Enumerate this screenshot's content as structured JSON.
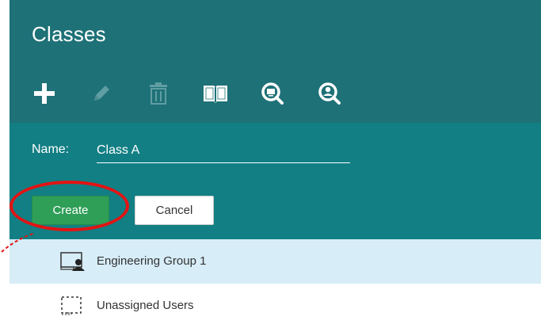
{
  "header": {
    "title": "Classes"
  },
  "toolbar": [
    {
      "name": "add-icon",
      "enabled": true
    },
    {
      "name": "edit-icon",
      "enabled": false
    },
    {
      "name": "delete-icon",
      "enabled": false
    },
    {
      "name": "book-icon",
      "enabled": true
    },
    {
      "name": "monitor-search-icon",
      "enabled": true
    },
    {
      "name": "user-search-icon",
      "enabled": true
    }
  ],
  "form": {
    "name_label": "Name:",
    "name_value": "Class A",
    "create_label": "Create",
    "cancel_label": "Cancel"
  },
  "list": {
    "items": [
      {
        "label": "Engineering Group 1",
        "icon": "computer-group-icon",
        "selected": true
      },
      {
        "label": "Unassigned Users",
        "icon": "dashed-group-icon",
        "selected": false
      }
    ]
  },
  "colors": {
    "header_bg": "#1e7177",
    "form_bg": "#127f84",
    "create_button": "#2f9e57",
    "selected_row": "#d7edf7",
    "highlight": "#e31313",
    "disabled_icon": "#5f9ea3"
  }
}
